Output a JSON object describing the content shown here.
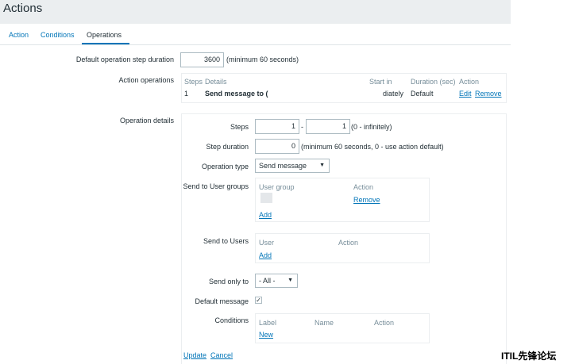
{
  "page": {
    "title": "Actions"
  },
  "tabs": [
    {
      "label": "Action"
    },
    {
      "label": "Conditions"
    },
    {
      "label": "Operations"
    }
  ],
  "form": {
    "default_step_duration": {
      "label": "Default operation step duration",
      "value": "3600",
      "hint": "(minimum 60 seconds)"
    },
    "action_operations": {
      "label": "Action operations",
      "headers": {
        "steps": "Steps",
        "details": "Details",
        "start_in": "Start in",
        "duration": "Duration (sec)",
        "action": "Action"
      },
      "rows": [
        {
          "step": "1",
          "details": "Send message to (",
          "start_in": "diately",
          "duration": "Default",
          "edit": "Edit",
          "remove": "Remove"
        }
      ]
    },
    "operation_details": {
      "label": "Operation details",
      "steps": {
        "label": "Steps",
        "from": "1",
        "separator": "-",
        "to": "1",
        "hint": "(0 - infinitely)"
      },
      "step_duration": {
        "label": "Step duration",
        "value": "0",
        "hint": "(minimum 60 seconds, 0 - use action default)"
      },
      "operation_type": {
        "label": "Operation type",
        "value": "Send message"
      },
      "send_to_user_groups": {
        "label": "Send to User groups",
        "col_group": "User group",
        "col_action": "Action",
        "remove": "Remove",
        "add": "Add"
      },
      "send_to_users": {
        "label": "Send to Users",
        "col_user": "User",
        "col_action": "Action",
        "add": "Add"
      },
      "send_only_to": {
        "label": "Send only to",
        "value": "- All -"
      },
      "default_message": {
        "label": "Default message",
        "checked": true
      },
      "conditions": {
        "label": "Conditions",
        "col_label": "Label",
        "col_name": "Name",
        "col_action": "Action",
        "new": "New"
      }
    },
    "buttons": {
      "update": "Update",
      "cancel": "Cancel"
    }
  },
  "watermark": {
    "text": "ITIL先锋论坛"
  }
}
